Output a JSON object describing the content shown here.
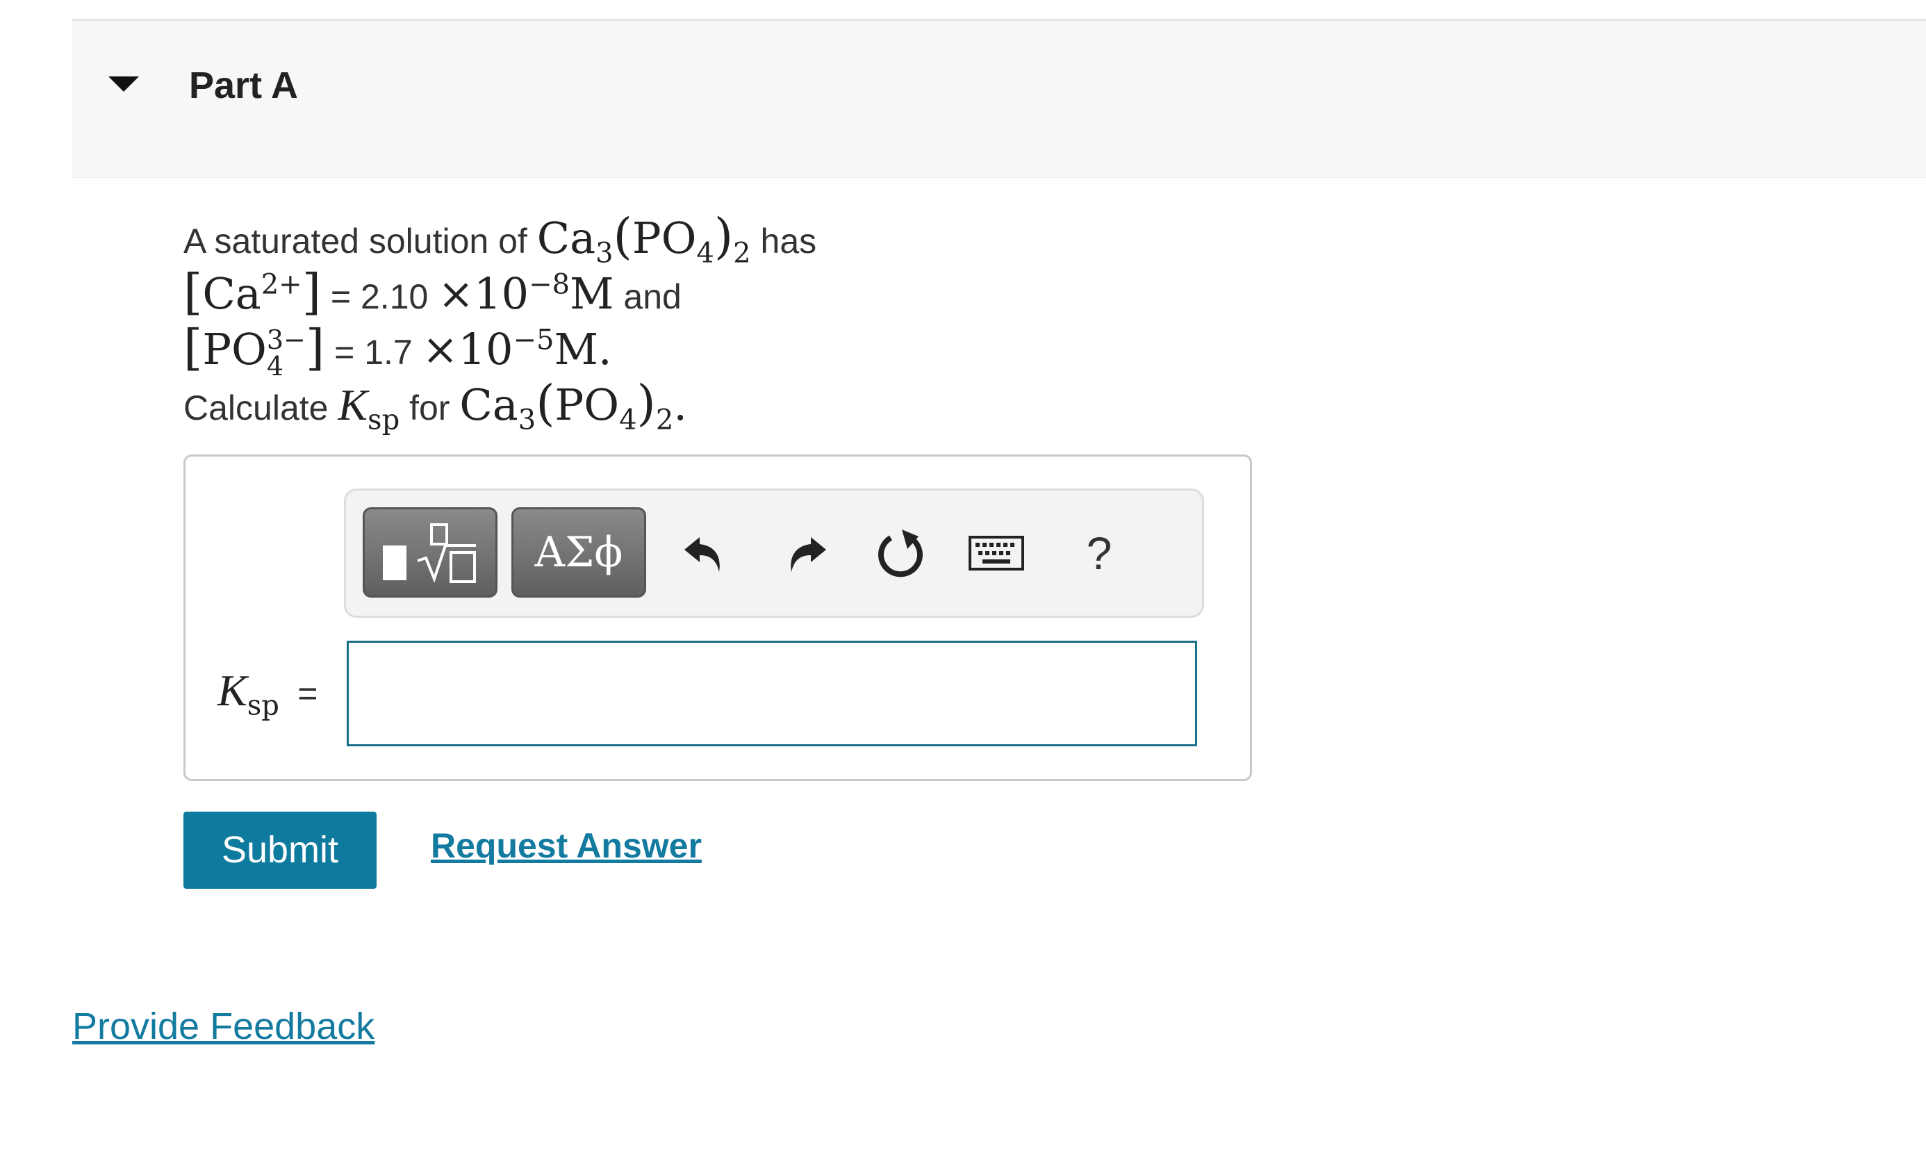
{
  "part": {
    "title": "Part A"
  },
  "problem": {
    "line1_prefix": "A saturated solution of",
    "line1_suffix": "has",
    "compound_base": "Ca",
    "compound_ca_subscript": "3",
    "compound_open": "(",
    "compound_phosphate": "PO",
    "compound_phosphate_subscript": "4",
    "compound_close": ")",
    "compound_outer_subscript": "2",
    "ca_ion_bracket_open": "[",
    "ca_ion_symbol": "Ca",
    "ca_ion_charge": "2+",
    "ca_ion_bracket_close": "]",
    "ca_conc_eq": "= 2.10",
    "times": "×10",
    "ca_exponent": "−8",
    "molar_unit": "M",
    "line2_suffix": "and",
    "po4_ion_symbol": "PO",
    "po4_ion_charge": "3−",
    "po4_ion_subscript": "4",
    "po4_conc_eq": "= 1.7",
    "po4_exponent": "−5",
    "period": ".",
    "line4_prefix": "Calculate",
    "ksp_symbol": "K",
    "ksp_subscript": "sp",
    "line4_mid": "for"
  },
  "toolbar": {
    "template_icon": "templates-radical-icon",
    "greek_label": "ΑΣϕ",
    "undo_icon": "undo-arrow-icon",
    "redo_icon": "redo-arrow-icon",
    "reset_icon": "reset-circular-arrow-icon",
    "keyboard_icon": "keyboard-icon",
    "help_label": "?"
  },
  "answer": {
    "label_symbol": "K",
    "label_subscript": "sp",
    "equals": "=",
    "value": ""
  },
  "actions": {
    "submit_label": "Submit",
    "request_answer_label": "Request Answer"
  },
  "footer": {
    "feedback_label": "Provide Feedback"
  },
  "colors": {
    "accent": "#0d7a9e",
    "link": "#137aa0",
    "input_border": "#1a6f8c",
    "header_bg": "#f7f7f7"
  }
}
